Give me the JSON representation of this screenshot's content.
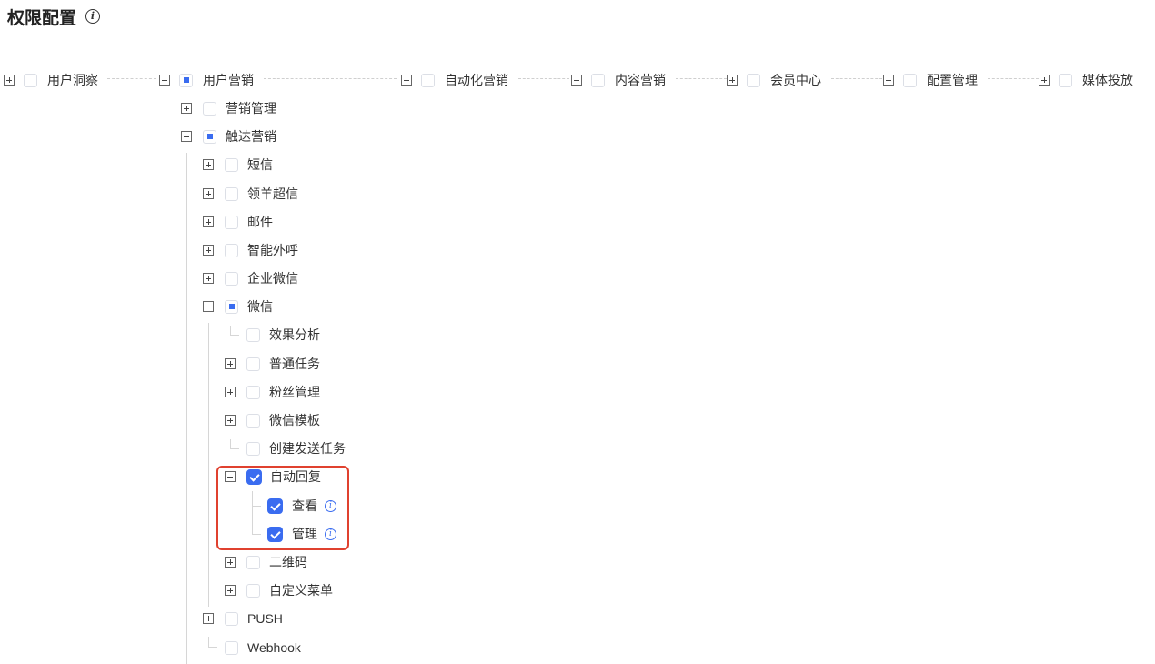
{
  "page": {
    "title": "权限配置"
  },
  "top_modules": [
    {
      "label": "用户洞察",
      "state": "unchecked",
      "expanded": false
    },
    {
      "label": "用户营销",
      "state": "indeterminate",
      "expanded": true
    },
    {
      "label": "自动化营销",
      "state": "unchecked",
      "expanded": false
    },
    {
      "label": "内容营销",
      "state": "unchecked",
      "expanded": false
    },
    {
      "label": "会员中心",
      "state": "unchecked",
      "expanded": false
    },
    {
      "label": "配置管理",
      "state": "unchecked",
      "expanded": false
    },
    {
      "label": "媒体投放",
      "state": "unchecked",
      "expanded": false
    }
  ],
  "marketing": {
    "level1": [
      {
        "label": "营销管理",
        "state": "unchecked",
        "expanded": false
      },
      {
        "label": "触达营销",
        "state": "indeterminate",
        "expanded": true
      }
    ],
    "touch": [
      {
        "label": "短信",
        "state": "unchecked",
        "expanded": false
      },
      {
        "label": "领羊超信",
        "state": "unchecked",
        "expanded": false
      },
      {
        "label": "邮件",
        "state": "unchecked",
        "expanded": false
      },
      {
        "label": "智能外呼",
        "state": "unchecked",
        "expanded": false
      },
      {
        "label": "企业微信",
        "state": "unchecked",
        "expanded": false
      },
      {
        "label": "微信",
        "state": "indeterminate",
        "expanded": true
      },
      {
        "label": "PUSH",
        "state": "unchecked",
        "expanded": false
      },
      {
        "label": "Webhook",
        "state": "unchecked",
        "leaf": true
      }
    ],
    "wechat": [
      {
        "label": "效果分析",
        "state": "unchecked",
        "leaf": true
      },
      {
        "label": "普通任务",
        "state": "unchecked",
        "expanded": false
      },
      {
        "label": "粉丝管理",
        "state": "unchecked",
        "expanded": false
      },
      {
        "label": "微信模板",
        "state": "unchecked",
        "expanded": false
      },
      {
        "label": "创建发送任务",
        "state": "unchecked",
        "leaf": true
      },
      {
        "label": "自动回复",
        "state": "checked",
        "expanded": true
      },
      {
        "label": "二维码",
        "state": "unchecked",
        "expanded": false
      },
      {
        "label": "自定义菜单",
        "state": "unchecked",
        "expanded": false
      }
    ],
    "auto_reply": [
      {
        "label": "查看",
        "state": "checked"
      },
      {
        "label": "管理",
        "state": "checked"
      }
    ]
  },
  "colors": {
    "primary": "#3a6cf0",
    "highlight": "#e0412f",
    "border": "#dcdfe6"
  }
}
